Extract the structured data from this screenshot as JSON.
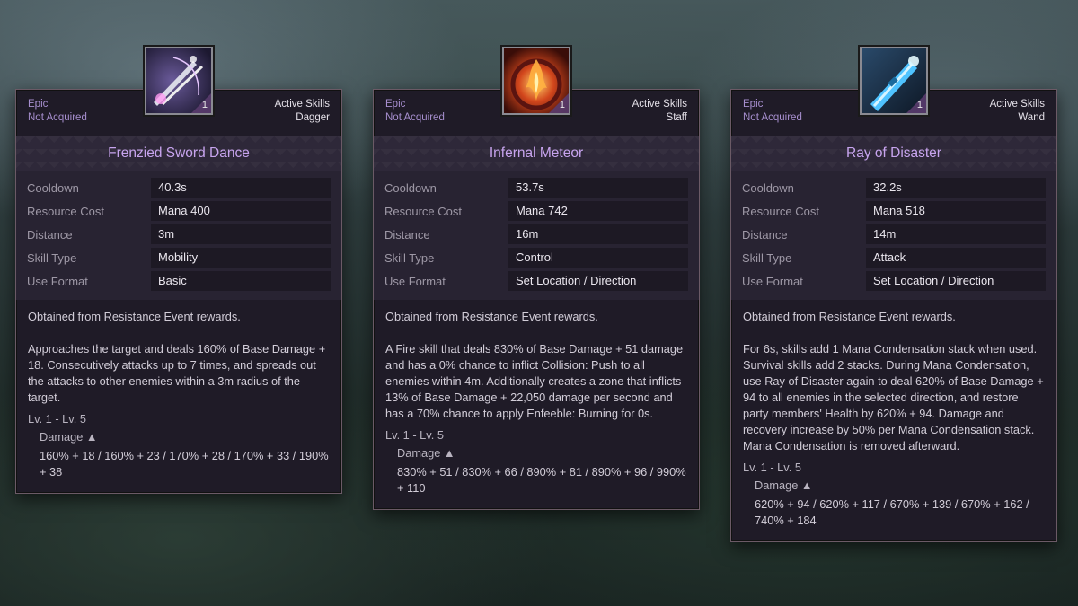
{
  "cards": [
    {
      "rarity": "Epic",
      "status": "Not Acquired",
      "category": "Active Skills",
      "weapon": "Dagger",
      "level_badge": "1",
      "icon": "crossed-blades-icon",
      "title": "Frenzied Sword Dance",
      "stats": [
        {
          "label": "Cooldown",
          "value": "40.3s"
        },
        {
          "label": "Resource Cost",
          "value": "Mana  400"
        },
        {
          "label": "Distance",
          "value": "3m"
        },
        {
          "label": "Skill Type",
          "value": "Mobility"
        },
        {
          "label": "Use Format",
          "value": "Basic"
        }
      ],
      "obtained": "Obtained from Resistance Event rewards.",
      "description": "Approaches the target and deals 160% of Base Damage + 18. Consecutively attacks up to 7 times, and spreads out the attacks to other enemies within a 3m radius of the target.",
      "level_range": "Lv. 1 - Lv. 5",
      "damage_label": "Damage ▲",
      "damage_values": "160% + 18 / 160% + 23 / 170% + 28 / 170% + 33 / 190% + 38"
    },
    {
      "rarity": "Epic",
      "status": "Not Acquired",
      "category": "Active Skills",
      "weapon": "Staff",
      "level_badge": "1",
      "icon": "fire-meteor-icon",
      "title": "Infernal Meteor",
      "stats": [
        {
          "label": "Cooldown",
          "value": "53.7s"
        },
        {
          "label": "Resource Cost",
          "value": "Mana  742"
        },
        {
          "label": "Distance",
          "value": "16m"
        },
        {
          "label": "Skill Type",
          "value": "Control"
        },
        {
          "label": "Use Format",
          "value": "Set Location / Direction"
        }
      ],
      "obtained": "Obtained from Resistance Event rewards.",
      "description": "A Fire skill that deals 830% of Base Damage + 51 damage and has a 0% chance to inflict Collision: Push to all enemies within 4m. Additionally creates a zone that inflicts 13% of Base Damage + 22,050 damage per second and has a 70% chance to apply Enfeeble: Burning for 0s.",
      "level_range": "Lv. 1 - Lv. 5",
      "damage_label": "Damage ▲",
      "damage_values": "830% + 51 / 830% + 66 / 890% + 81 / 890% + 96 / 990% + 110"
    },
    {
      "rarity": "Epic",
      "status": "Not Acquired",
      "category": "Active Skills",
      "weapon": "Wand",
      "level_badge": "1",
      "icon": "ice-wand-icon",
      "title": "Ray of Disaster",
      "stats": [
        {
          "label": "Cooldown",
          "value": "32.2s"
        },
        {
          "label": "Resource Cost",
          "value": "Mana  518"
        },
        {
          "label": "Distance",
          "value": "14m"
        },
        {
          "label": "Skill Type",
          "value": "Attack"
        },
        {
          "label": "Use Format",
          "value": "Set Location / Direction"
        }
      ],
      "obtained": "Obtained from Resistance Event rewards.",
      "description": "For 6s, skills add 1 Mana Condensation stack when used. Survival skills add 2 stacks. During Mana Condensation, use Ray of Disaster again to deal 620% of Base Damage + 94 to all enemies in the selected direction, and restore party members' Health by 620% + 94. Damage and recovery increase by 50% per Mana Condensation stack. Mana Condensation is removed afterward.",
      "level_range": "Lv. 1 - Lv. 5",
      "damage_label": "Damage ▲",
      "damage_values": "620% + 94 / 620% + 117 / 670% + 139 / 670% + 162 / 740% + 184"
    }
  ]
}
